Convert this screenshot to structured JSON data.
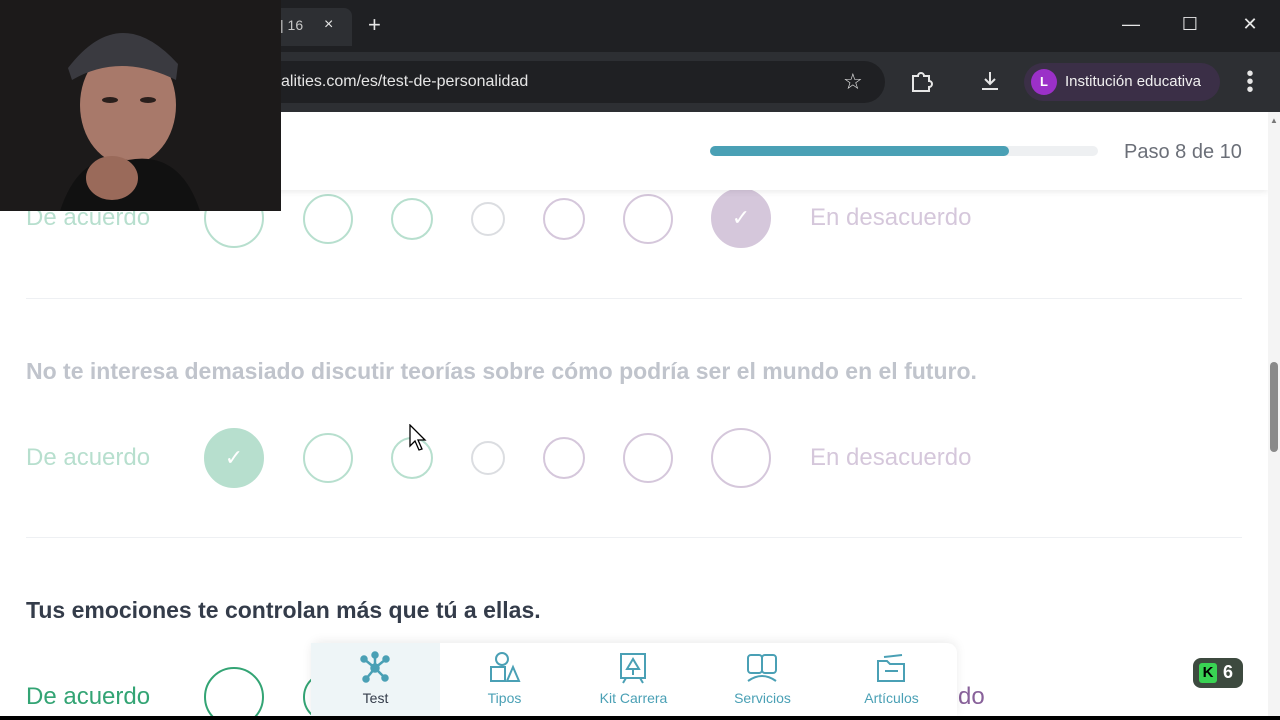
{
  "browser": {
    "tab_title": "| 16",
    "tab_close": "×",
    "new_tab": "+",
    "url": "alities.com/es/test-de-personalidad",
    "profile_initial": "L",
    "profile_name": "Institución educativa",
    "window_controls": {
      "minimize": "—",
      "maximize": "☐",
      "close": "✕"
    }
  },
  "header": {
    "step_label": "Paso 8 de 10",
    "progress_fraction": 0.77
  },
  "questions": [
    {
      "text": "",
      "agree_label": "De acuerdo",
      "disagree_label": "En desacuerdo",
      "selected_index": 6,
      "faded": true
    },
    {
      "text": "No te interesa demasiado discutir teorías sobre cómo podría ser el mundo en el futuro.",
      "agree_label": "De acuerdo",
      "disagree_label": "En desacuerdo",
      "selected_index": 0,
      "faded": true
    },
    {
      "text": "Tus emociones te controlan más que tú a ellas.",
      "agree_label": "De acuerdo",
      "disagree_label": "do",
      "selected_index": null,
      "faded": false
    }
  ],
  "check_glyph": "✓",
  "bottom_nav": [
    {
      "label": "Test",
      "icon": "network-icon",
      "active": true
    },
    {
      "label": "Tipos",
      "icon": "shapes-icon",
      "active": false
    },
    {
      "label": "Kit Carrera",
      "icon": "easel-icon",
      "active": false
    },
    {
      "label": "Servicios",
      "icon": "people-icon",
      "active": false
    },
    {
      "label": "Artículos",
      "icon": "folder-icon",
      "active": false
    }
  ],
  "badge": {
    "letter": "K",
    "count": "6"
  },
  "colors": {
    "agree": "#33a474",
    "disagree": "#88619a",
    "progress": "#4aa0b5",
    "text": "#343c4a"
  }
}
